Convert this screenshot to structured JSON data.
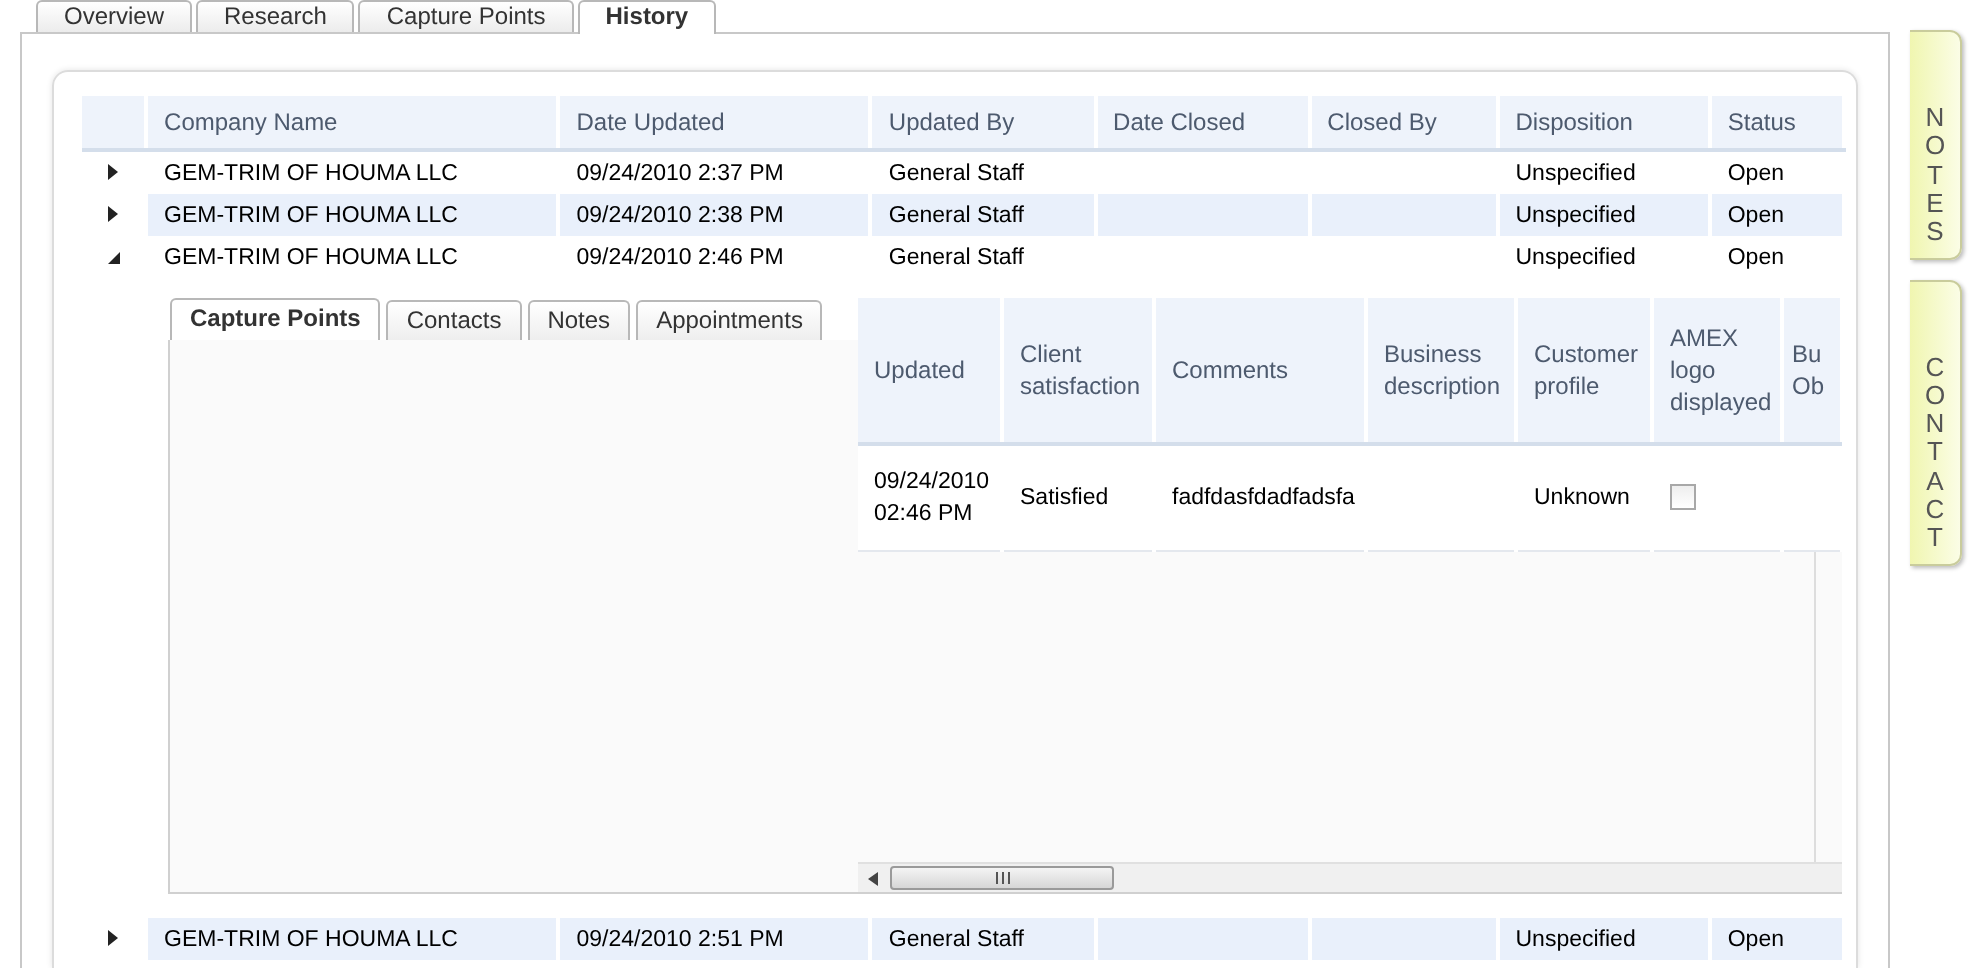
{
  "tabs": [
    {
      "label": "Overview",
      "selected": false
    },
    {
      "label": "Research",
      "selected": false
    },
    {
      "label": "Capture Points",
      "selected": false
    },
    {
      "label": "History",
      "selected": true
    }
  ],
  "side_tabs": [
    {
      "label": "NOTES"
    },
    {
      "label": "CONTACT"
    }
  ],
  "table": {
    "columns": [
      "Company Name",
      "Date Updated",
      "Updated By",
      "Date Closed",
      "Closed By",
      "Disposition",
      "Status"
    ],
    "rows": [
      {
        "company": "GEM-TRIM OF HOUMA LLC",
        "date_updated": "09/24/2010 2:37 PM",
        "updated_by": "General Staff",
        "disposition": "Unspecified",
        "status": "Open",
        "expanded": false
      },
      {
        "company": "GEM-TRIM OF HOUMA LLC",
        "date_updated": "09/24/2010 2:38 PM",
        "updated_by": "General Staff",
        "disposition": "Unspecified",
        "status": "Open",
        "expanded": false
      },
      {
        "company": "GEM-TRIM OF HOUMA LLC",
        "date_updated": "09/24/2010 2:46 PM",
        "updated_by": "General Staff",
        "disposition": "Unspecified",
        "status": "Open",
        "expanded": true,
        "detail": {
          "tabs": [
            {
              "label": "Capture Points",
              "selected": true
            },
            {
              "label": "Contacts",
              "selected": false
            },
            {
              "label": "Notes",
              "selected": false
            },
            {
              "label": "Appointments",
              "selected": false
            }
          ],
          "columns": [
            "Updated",
            "Client satisfaction",
            "Comments",
            "Business description",
            "Customer profile",
            "AMEX logo displayed",
            "Bu Ob"
          ],
          "rows": [
            {
              "updated": "09/24/2010 02:46 PM",
              "client_satisfaction": "Satisfied",
              "comments": "fadfdasfdadfadsfa",
              "customer_profile": "Unknown",
              "amex_logo_displayed": false
            }
          ]
        }
      },
      {
        "company": "GEM-TRIM OF HOUMA LLC",
        "date_updated": "09/24/2010 2:51 PM",
        "updated_by": "General Staff",
        "disposition": "Unspecified",
        "status": "Open",
        "expanded": false
      }
    ]
  }
}
